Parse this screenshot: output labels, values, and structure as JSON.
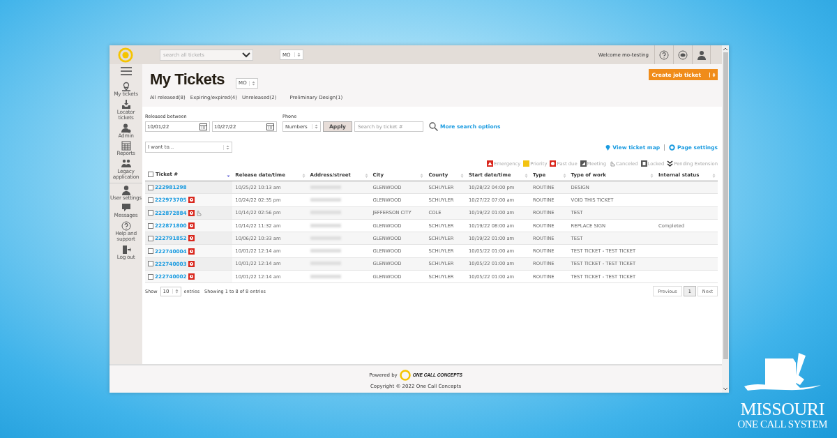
{
  "topbar": {
    "search_placeholder": "search all tickets",
    "state": "MO",
    "welcome": "Welcome mo-testing"
  },
  "sidebar": {
    "items": [
      {
        "label": "My tickets",
        "kind": "pin"
      },
      {
        "label": "Locator tickets",
        "kind": "inbox"
      },
      {
        "label": "Admin",
        "kind": "admin"
      },
      {
        "label": "Reports",
        "kind": "grid"
      },
      {
        "label": "Legacy application",
        "kind": "people",
        "divider_after": true
      },
      {
        "label": "User settings",
        "kind": "user"
      },
      {
        "label": "Messages",
        "kind": "chat"
      },
      {
        "label": "Help and support",
        "kind": "help"
      },
      {
        "label": "Log out",
        "kind": "logout"
      }
    ]
  },
  "header": {
    "title": "My Tickets",
    "state": "MO",
    "create_button": "Create job ticket",
    "tabs": [
      "All released(8)",
      "Expiring/expired(4)",
      "Unreleased(2)",
      "Preliminary Design(1)"
    ]
  },
  "filters": {
    "released_label": "Released between",
    "from": "10/01/22",
    "to": "10/27/22",
    "phone_label": "Phone",
    "phone_select": "Numbers",
    "apply": "Apply",
    "ticket_placeholder": "Search by ticket #",
    "more": "More search options",
    "action_select": "I want to...",
    "view_map": "View ticket map",
    "page_settings": "Page settings"
  },
  "legend": [
    {
      "label": "Emergency",
      "kind": "emergency"
    },
    {
      "label": "Priority",
      "kind": "priority"
    },
    {
      "label": "Past due",
      "kind": "past_due"
    },
    {
      "label": "Meeting",
      "kind": "meeting"
    },
    {
      "label": "Canceled",
      "kind": "canceled"
    },
    {
      "label": "Locked",
      "kind": "locked"
    },
    {
      "label": "Pending Extension",
      "kind": "pending"
    }
  ],
  "table": {
    "select_all_checked": false,
    "columns": [
      {
        "label": "Ticket #",
        "sorted": true
      },
      {
        "label": "Release date/time",
        "sorted": false
      },
      {
        "label": "Address/street",
        "sorted": false
      },
      {
        "label": "City",
        "sorted": false
      },
      {
        "label": "County",
        "sorted": false
      },
      {
        "label": "Start date/time",
        "sorted": false
      },
      {
        "label": "Type",
        "sorted": false
      },
      {
        "label": "Type of work",
        "sorted": false
      },
      {
        "label": "Internal status",
        "sorted": false
      }
    ],
    "rows": [
      {
        "ticket": "222981298",
        "past_due": false,
        "canceled": false,
        "checked": false,
        "address_blurred": true,
        "release": "10/25/22 10:13 am",
        "city": "GLENWOOD",
        "county": "SCHUYLER",
        "start": "10/28/22 04:00 pm",
        "type": "ROUTINE",
        "work": "DESIGN"
      },
      {
        "ticket": "222973705",
        "past_due": true,
        "canceled": false,
        "checked": false,
        "address_blurred": true,
        "release": "10/24/22 02:35 pm",
        "city": "GLENWOOD",
        "county": "SCHUYLER",
        "start": "10/27/22 07:00 am",
        "type": "ROUTINE",
        "work": "VOID THIS TICKET"
      },
      {
        "ticket": "222872884",
        "past_due": true,
        "canceled": true,
        "checked": false,
        "address_blurred": true,
        "release": "10/14/22 02:56 pm",
        "city": "JEFFERSON CITY",
        "county": "COLE",
        "start": "10/19/22 01:00 am",
        "type": "ROUTINE",
        "work": "TEST"
      },
      {
        "ticket": "222871800",
        "past_due": true,
        "canceled": false,
        "checked": false,
        "address_blurred": true,
        "release": "10/14/22 11:32 am",
        "city": "GLENWOOD",
        "county": "SCHUYLER",
        "start": "10/19/22 08:00 am",
        "type": "ROUTINE",
        "work": "REPLACE SIGN",
        "status": "Completed"
      },
      {
        "ticket": "222791852",
        "past_due": true,
        "canceled": false,
        "checked": false,
        "address_blurred": true,
        "release": "10/06/22 10:33 am",
        "city": "GLENWOOD",
        "county": "SCHUYLER",
        "start": "10/19/22 01:00 am",
        "type": "ROUTINE",
        "work": "TEST"
      },
      {
        "ticket": "222740004",
        "past_due": true,
        "canceled": false,
        "checked": false,
        "address_blurred": true,
        "release": "10/01/22 12:14 am",
        "city": "GLENWOOD",
        "county": "SCHUYLER",
        "start": "10/05/22 01:00 am",
        "type": "ROUTINE",
        "work": "TEST TICKET - TEST TICKET"
      },
      {
        "ticket": "222740003",
        "past_due": true,
        "canceled": false,
        "checked": false,
        "address_blurred": true,
        "release": "10/01/22 12:14 am",
        "city": "GLENWOOD",
        "county": "SCHUYLER",
        "start": "10/05/22 01:00 am",
        "type": "ROUTINE",
        "work": "TEST TICKET - TEST TICKET"
      },
      {
        "ticket": "222740002",
        "past_due": true,
        "canceled": false,
        "checked": false,
        "address_blurred": true,
        "release": "10/01/22 12:14 am",
        "city": "GLENWOOD",
        "county": "SCHUYLER",
        "start": "10/05/22 01:00 am",
        "type": "ROUTINE",
        "work": "TEST TICKET - TEST TICKET"
      }
    ]
  },
  "table_footer": {
    "show": "Show",
    "page_size": "10",
    "entries": "entries",
    "info": "Showing 1 to 8 of 8 entries",
    "pages": [
      {
        "label": "Previous",
        "selected": false
      },
      {
        "label": "1",
        "selected": true
      },
      {
        "label": "Next",
        "selected": false
      }
    ]
  },
  "footer": {
    "powered_by": "Powered by",
    "logo_text": "ONE CALL CONCEPTS",
    "copyright": "Copyright © 2022 One Call Concepts"
  },
  "brand": {
    "line1": "MISSOURI",
    "line2": "ONE CALL SYSTEM"
  }
}
